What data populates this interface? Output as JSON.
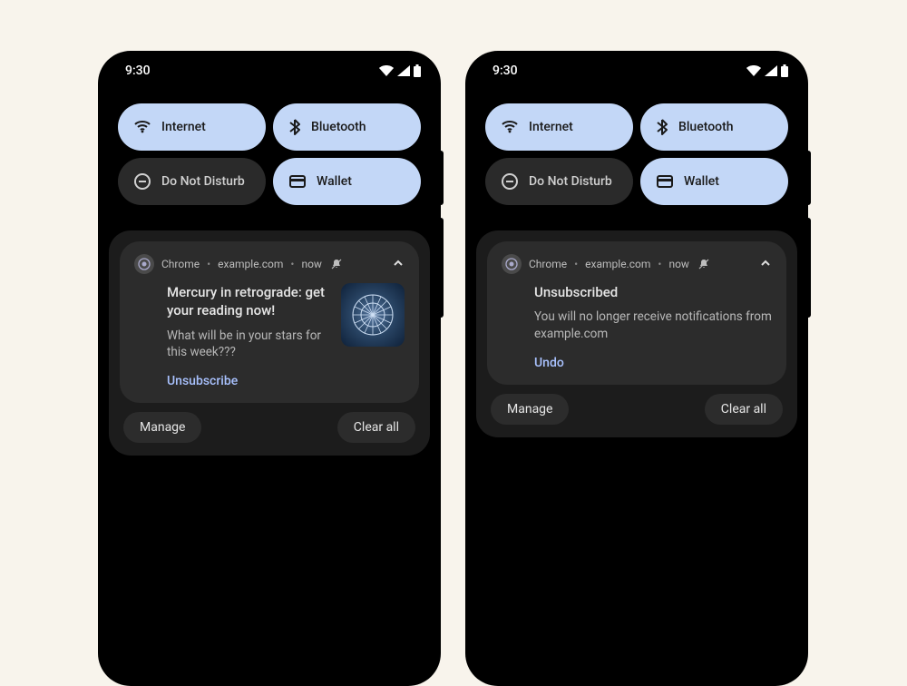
{
  "status_time": "9:30",
  "qs": {
    "internet": "Internet",
    "bluetooth": "Bluetooth",
    "dnd": "Do Not Disturb",
    "wallet": "Wallet"
  },
  "notif_head": {
    "app": "Chrome",
    "site": "example.com",
    "time": "now"
  },
  "left_notif": {
    "title": "Mercury in retrograde: get your reading now!",
    "body": "What will be in your stars for this week???",
    "action": "Unsubscribe"
  },
  "right_notif": {
    "title": "Unsubscribed",
    "body": "You will no longer receive notifications from example.com",
    "action": "Undo"
  },
  "footer": {
    "manage": "Manage",
    "clear": "Clear all"
  }
}
